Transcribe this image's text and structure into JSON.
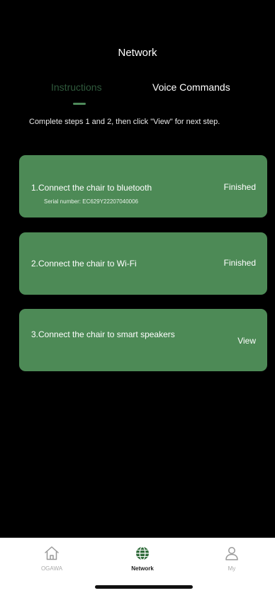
{
  "header": {
    "title": "Network"
  },
  "tabs": [
    {
      "label": "Instructions",
      "active": true
    },
    {
      "label": "Voice Commands",
      "active": false
    }
  ],
  "instruction": "Complete steps 1 and 2, then click \"View\" for next step.",
  "steps": [
    {
      "title": "1.Connect the chair to bluetooth",
      "serial": "Serial number: EC629Y22207040006",
      "status": "Finished"
    },
    {
      "title": "2.Connect the chair to Wi-Fi",
      "status": "Finished"
    },
    {
      "title": "3.Connect the chair to smart speakers",
      "status": "View"
    }
  ],
  "bottom_nav": [
    {
      "label": "OGAWA",
      "icon": "home-icon",
      "active": false
    },
    {
      "label": "Network",
      "icon": "globe-icon",
      "active": true
    },
    {
      "label": "My",
      "icon": "user-icon",
      "active": false
    }
  ],
  "colors": {
    "background": "#000000",
    "card": "#4d8a56",
    "accent": "#2f5a3c",
    "nav_background": "#ffffff"
  }
}
